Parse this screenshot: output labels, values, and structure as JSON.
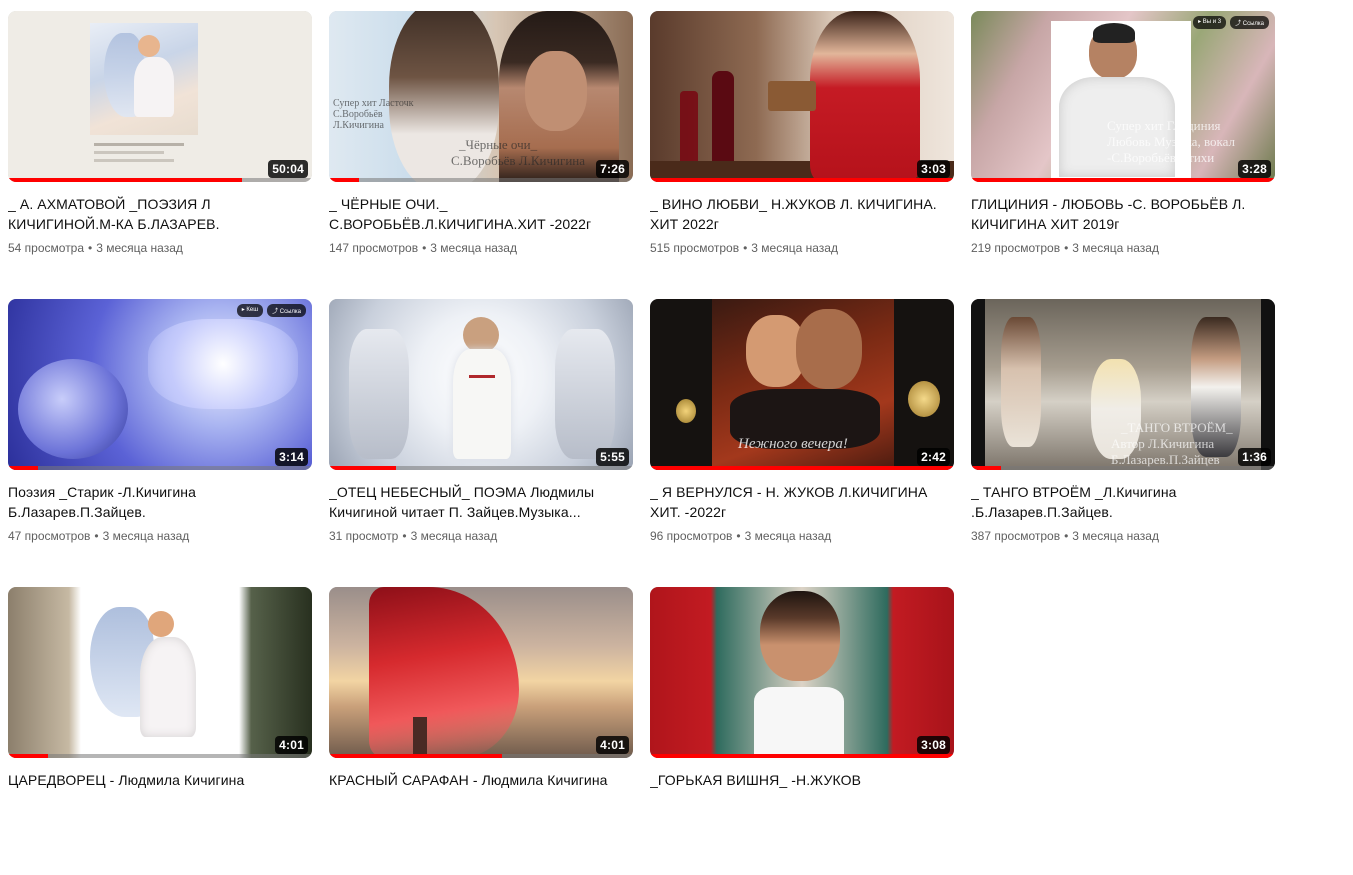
{
  "videos": [
    {
      "title": "_ А. АХМАТОВОЙ _ПОЭЗИЯ Л КИЧИГИНОЙ.М-КА Б.ЛАЗАРЕВ.",
      "views": "54 просмотра",
      "age": "3 месяца назад",
      "duration": "50:04",
      "progress": 0.77
    },
    {
      "title": "_ ЧЁРНЫЕ ОЧИ._ С.ВОРОБЬЁВ.Л.КИЧИГИНА.ХИТ -2022г",
      "views": "147 просмотров",
      "age": "3 месяца назад",
      "duration": "7:26",
      "progress": 0.1,
      "overlay_1": "Супер хит Ласточк",
      "overlay_2": "С.Воробьёв",
      "overlay_3": "Л.Кичигина",
      "overlay_4": "_Чёрные очи_",
      "overlay_5": "С.Воробьёв Л.Кичигина"
    },
    {
      "title": "_ ВИНО ЛЮБВИ_ Н.ЖУКОВ Л. КИЧИГИНА. ХИТ 2022г",
      "views": "515 просмотров",
      "age": "3 месяца назад",
      "duration": "3:03",
      "progress": 1.0
    },
    {
      "title": "ГЛИЦИНИЯ - ЛЮБОВЬ -С. ВОРОБЬЁВ Л. КИЧИГИНА ХИТ 2019г",
      "views": "219 просмотров",
      "age": "3 месяца назад",
      "duration": "3:28",
      "progress": 1.0,
      "overlay_1": "Супер хит Глициния",
      "overlay_2": "Любовь Музыка, вокал",
      "overlay_3": "-С.Воробьёв. стихи"
    },
    {
      "title": "Поэзия _Старик -Л.Кичигина Б.Лазарев.П.Зайцев.",
      "views": "47 просмотров",
      "age": "3 месяца назад",
      "duration": "3:14",
      "progress": 0.1
    },
    {
      "title": "_ОТЕЦ НЕБЕСНЫЙ_ ПОЭМА Людмилы Кичигиной читает П. Зайцев.Музыка...",
      "views": "31 просмотр",
      "age": "3 месяца назад",
      "duration": "5:55",
      "progress": 0.22
    },
    {
      "title": "_ Я ВЕРНУЛСЯ - Н. ЖУКОВ Л.КИЧИГИНА ХИТ. -2022г",
      "views": "96 просмотров",
      "age": "3 месяца назад",
      "duration": "2:42",
      "progress": 1.0,
      "overlay_1": "Нежного вечера!"
    },
    {
      "title": "_ ТАНГО ВТРОЁМ _Л.Кичигина .Б.Лазарев.П.Зайцев.",
      "views": "387 просмотров",
      "age": "3 месяца назад",
      "duration": "1:36",
      "progress": 0.1,
      "overlay_1": "_ТАНГО ВТРОЁМ_",
      "overlay_2": "Автор Л.Кичигина",
      "overlay_3": "Б.Лазарев.П.Зайцев"
    },
    {
      "title": "ЦАРЕДВОРЕЦ - Людмила Кичигина",
      "views": "",
      "age": "",
      "duration": "4:01",
      "progress": 0.13
    },
    {
      "title": "КРАСНЫЙ САРАФАН - Людмила Кичигина",
      "views": "",
      "age": "",
      "duration": "4:01",
      "progress": 0.57
    },
    {
      "title": "_ГОРЬКАЯ ВИШНЯ_ -Н.ЖУКОВ",
      "views": "",
      "age": "",
      "duration": "3:08",
      "progress": 1.0
    }
  ],
  "colors": {
    "accent": "#ff0000",
    "meta": "#606060",
    "title": "#0f0f0f"
  }
}
